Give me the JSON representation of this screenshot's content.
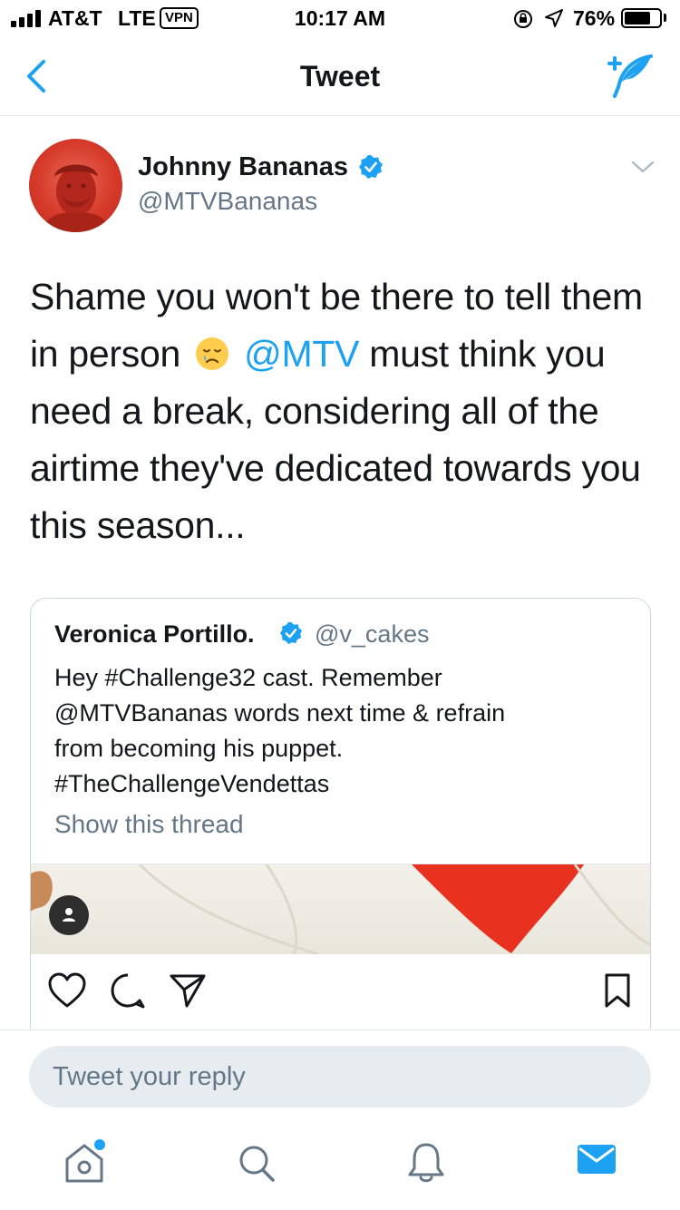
{
  "status_bar": {
    "carrier": "AT&T",
    "network": "LTE",
    "vpn": "VPN",
    "time": "10:17 AM",
    "battery": "76%",
    "battery_level": 0.76
  },
  "nav": {
    "title": "Tweet"
  },
  "tweet": {
    "author_name": "Johnny Bananas",
    "author_handle": "@MTVBananas",
    "text_1": "Shame you won't be there to tell them in person",
    "mention": "@MTV",
    "text_2": "must think you need a break, considering all of the airtime they've dedicated towards you this season..."
  },
  "quote": {
    "author_name": "Veronica Portillo.",
    "author_handle": "@v_cakes",
    "text": "Hey #Challenge32 cast.  Remember\n@MTVBananas words next time & refrain\nfrom becoming his puppet.\n#TheChallengeVendettas",
    "show_thread": "Show this thread"
  },
  "reply": {
    "placeholder": "Tweet your reply"
  },
  "icons": {
    "brand_blue": "#1da1f2",
    "text_gray": "#657786"
  }
}
